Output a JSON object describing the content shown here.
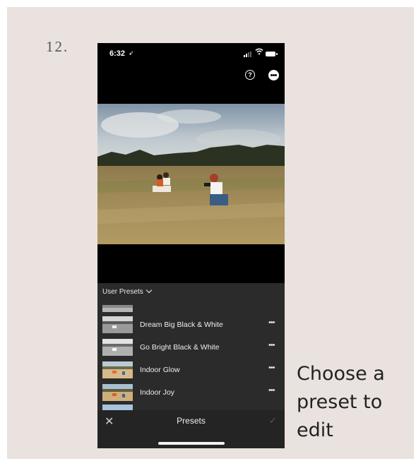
{
  "step": {
    "number": "12."
  },
  "caption": {
    "text": "Choose a preset to edit"
  },
  "status_bar": {
    "time": "6:32",
    "location_icon": "location-arrow-icon"
  },
  "toolbar": {
    "help_icon": "help-circle-icon",
    "more_icon": "more-options-icon"
  },
  "presets_panel": {
    "group_title": "User Presets",
    "cutoff_label": "Dream Big Black & White",
    "items": [
      {
        "label": "Dream Big Black & White",
        "thumb": "bw"
      },
      {
        "label": "Go Bright Black & White",
        "thumb": "bw"
      },
      {
        "label": "Indoor Glow",
        "thumb": "color"
      },
      {
        "label": "Indoor Joy",
        "thumb": "color"
      }
    ]
  },
  "bottom_bar": {
    "title": "Presets",
    "close_icon": "close-icon",
    "confirm_icon": "checkmark-icon"
  },
  "colors": {
    "panel": "#2b2b2b",
    "bottom_bar": "#242424",
    "card": "#e9e2df"
  }
}
